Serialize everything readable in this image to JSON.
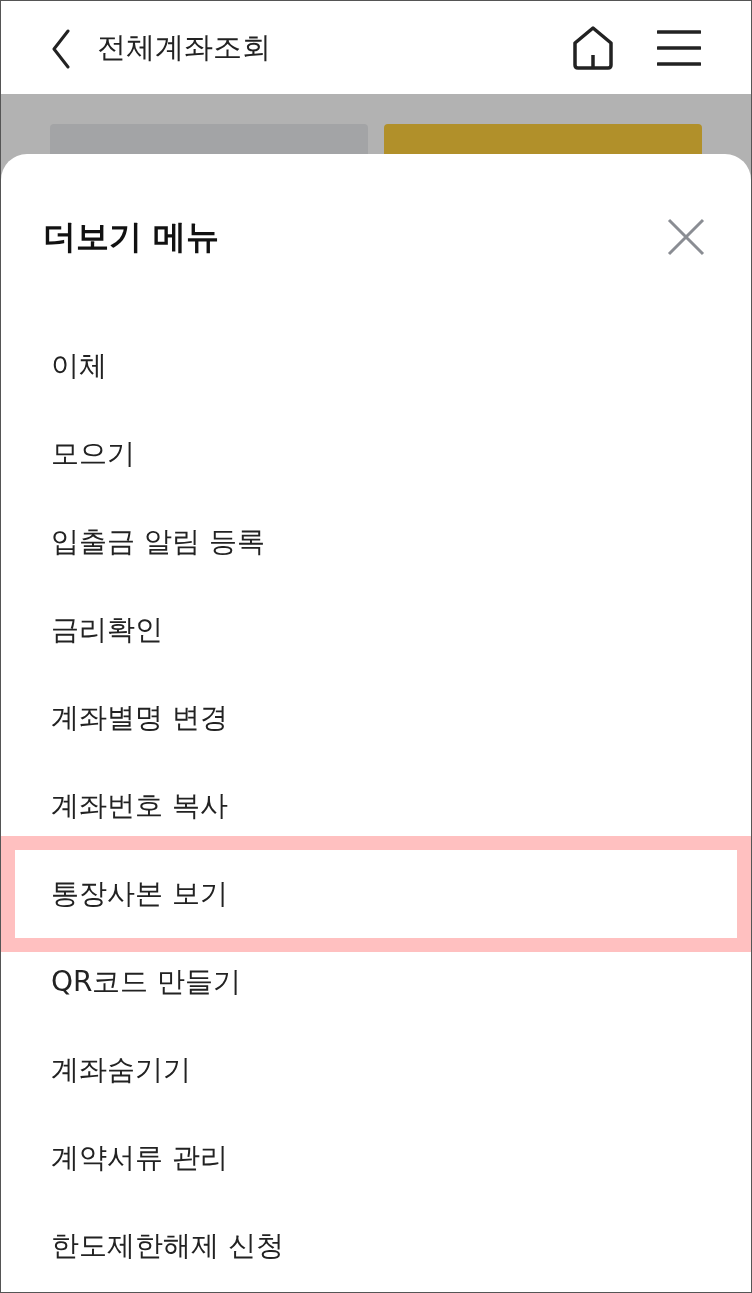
{
  "header": {
    "title": "전체계좌조회"
  },
  "background_buttons": [
    {
      "kind": "secondary"
    },
    {
      "kind": "primary"
    }
  ],
  "sheet": {
    "title": "더보기 메뉴",
    "items": [
      {
        "label": "이체",
        "highlighted": false
      },
      {
        "label": "모으기",
        "highlighted": false
      },
      {
        "label": "입출금 알림 등록",
        "highlighted": false
      },
      {
        "label": "금리확인",
        "highlighted": false
      },
      {
        "label": "계좌별명 변경",
        "highlighted": false
      },
      {
        "label": "계좌번호 복사",
        "highlighted": false
      },
      {
        "label": "통장사본 보기",
        "highlighted": true
      },
      {
        "label": "QR코드 만들기",
        "highlighted": false
      },
      {
        "label": "계좌숨기기",
        "highlighted": false
      },
      {
        "label": "계약서류 관리",
        "highlighted": false
      },
      {
        "label": "한도제한해제 신청",
        "highlighted": false
      }
    ]
  }
}
